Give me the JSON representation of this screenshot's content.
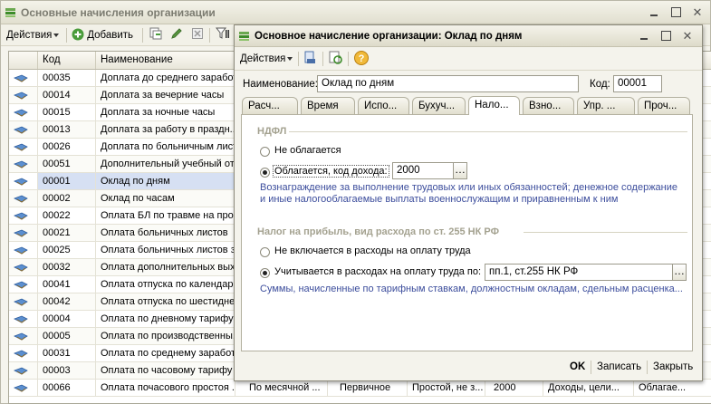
{
  "back_window": {
    "title": "Основные начисления организации",
    "toolbar": {
      "actions_label": "Действия",
      "add_label": "Добавить"
    },
    "columns": {
      "code": "Код",
      "name": "Наименование"
    },
    "rows": [
      {
        "code": "00035",
        "name": "Доплата до среднего заработ"
      },
      {
        "code": "00014",
        "name": "Доплата за вечерние часы"
      },
      {
        "code": "00015",
        "name": "Доплата за ночные часы"
      },
      {
        "code": "00013",
        "name": "Доплата за работу в праздн..."
      },
      {
        "code": "00026",
        "name": "Доплата по больничным лист..."
      },
      {
        "code": "00051",
        "name": "Дополнительный учебный от..."
      },
      {
        "code": "00001",
        "name": "Оклад по дням"
      },
      {
        "code": "00002",
        "name": "Оклад по часам"
      },
      {
        "code": "00022",
        "name": "Оплата БЛ по травме на про..."
      },
      {
        "code": "00021",
        "name": "Оплата больничных листов"
      },
      {
        "code": "00025",
        "name": "Оплата больничных листов з..."
      },
      {
        "code": "00032",
        "name": "Оплата дополнительных вых..."
      },
      {
        "code": "00041",
        "name": "Оплата отпуска по календар..."
      },
      {
        "code": "00042",
        "name": "Оплата отпуска по шестидне..."
      },
      {
        "code": "00004",
        "name": "Оплата по дневному тарифу"
      },
      {
        "code": "00005",
        "name": "Оплата по производственны..."
      },
      {
        "code": "00031",
        "name": "Оплата по среднему заработ..."
      },
      {
        "code": "00003",
        "name": "Оплата по часовому тарифу"
      },
      {
        "code": "00066",
        "name": "Оплата почасового простоя ..."
      }
    ],
    "last_row_extra": [
      "По месячной ...",
      "Первичное",
      "Простой, не з...",
      "2000",
      "Доходы, цели...",
      "Облагае..."
    ]
  },
  "dialog": {
    "title": "Основное начисление организации: Оклад по дням",
    "toolbar": {
      "actions_label": "Действия"
    },
    "name_label": "Наименование:",
    "name_value": "Оклад по дням",
    "code_label": "Код:",
    "code_value": "00001",
    "tabs": [
      "Расч...",
      "Время",
      "Испо...",
      "Бухуч...",
      "Нало...",
      "Взно...",
      "Упр. ...",
      "Проч..."
    ],
    "ndfl": {
      "header": "НДФЛ",
      "opt_not_taxed": "Не облагается",
      "opt_taxed": "Облагается, код дохода:",
      "income_code": "2000",
      "note_line1": "Вознаграждение за выполнение трудовых или иных обязанностей; денежное содержание",
      "note_line2": "и иные налогооблагаемые выплаты военнослужащим и приравненным к ним"
    },
    "profit": {
      "header": "Налог на прибыль, вид расхода по ст. 255 НК РФ",
      "opt_not_included": "Не включается в расходы на оплату труда",
      "opt_included": "Учитывается в расходах на оплату труда по:",
      "article_value": "пп.1, ст.255 НК РФ",
      "note": "Суммы, начисленные по тарифным ставкам, должностным окладам, сдельным расценка..."
    },
    "footer": {
      "ok_label": "OK",
      "save_label": "Записать",
      "close_label": "Закрыть"
    }
  }
}
